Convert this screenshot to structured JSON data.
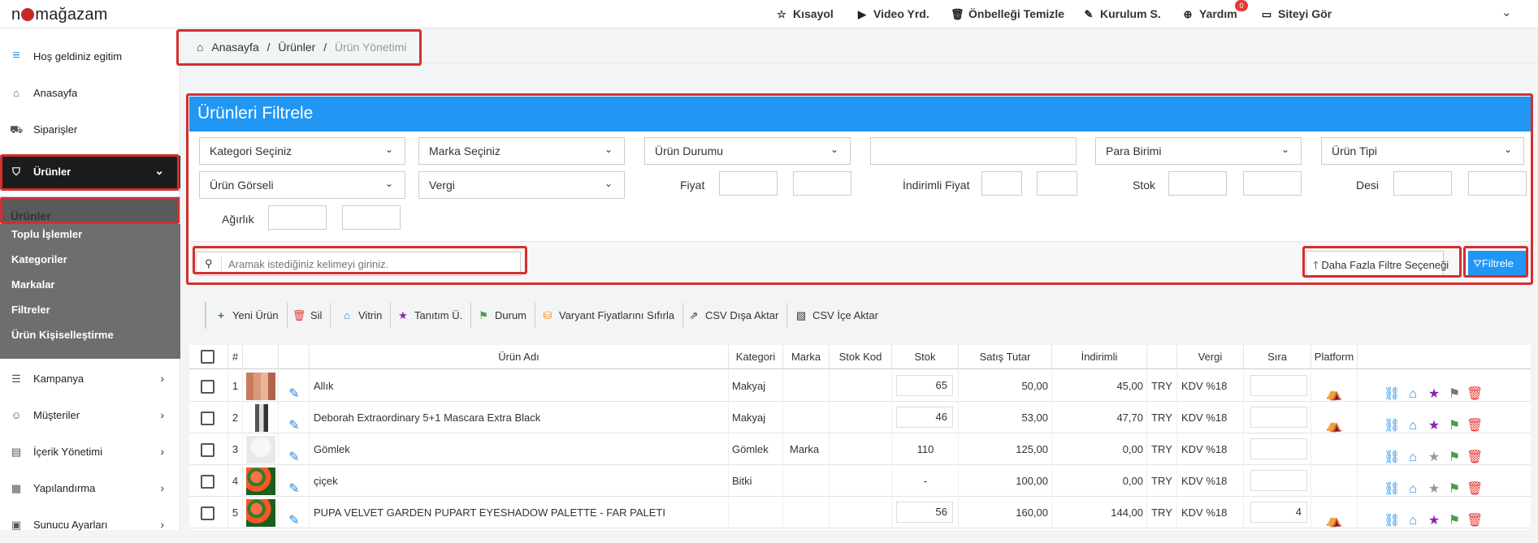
{
  "app": {
    "logo_left": "n",
    "logo_right": "mağazam"
  },
  "topnav": [
    {
      "icon": "star-outline-icon",
      "label": "Kısayol"
    },
    {
      "icon": "youtube-icon",
      "label": "Video Yrd."
    },
    {
      "icon": "trash-icon",
      "label": "Önbelleği Temizle"
    },
    {
      "icon": "magic-wand-icon",
      "label": "Kurulum S."
    },
    {
      "icon": "lifebuoy-icon",
      "label": "Yardım"
    },
    {
      "icon": "monitor-icon",
      "label": "Siteyi Gör"
    }
  ],
  "help_badge": "0",
  "sidebar": {
    "welcome": "Hoş geldiniz egitim",
    "items": [
      {
        "icon": "home-icon",
        "label": "Anasayfa"
      },
      {
        "icon": "cart-icon",
        "label": "Siparişler"
      },
      {
        "icon": "tag-icon",
        "label": "Ürünler"
      },
      {
        "icon": "list-icon",
        "label": "Kampanya"
      },
      {
        "icon": "user-icon",
        "label": "Müşteriler"
      },
      {
        "icon": "document-icon",
        "label": "İçerik Yönetimi"
      },
      {
        "icon": "settings-icon",
        "label": "Yapılandırma"
      },
      {
        "icon": "server-icon",
        "label": "Sunucu Ayarları"
      }
    ],
    "subitems": [
      "Ürünler",
      "Toplu İşlemler",
      "Kategoriler",
      "Markalar",
      "Filtreler",
      "Ürün Kişiselleştirme"
    ]
  },
  "breadcrumb": {
    "home": "Anasayfa",
    "sep": "/",
    "level2": "Ürünler",
    "current": "Ürün Yönetimi"
  },
  "filter": {
    "title": "Ürünleri Filtrele",
    "selects": [
      "Kategori Seçiniz",
      "Marka Seçiniz",
      "Ürün Durumu",
      "Para Birimi",
      "Ürün Tipi",
      "Ürün Görseli",
      "Vergi"
    ],
    "labels": [
      "Fiyat",
      "İndirimli Fiyat",
      "Stok",
      "Desi",
      "Ağırlık"
    ],
    "search_placeholder": "Aramak istediğiniz kelimeyi giriniz.",
    "more_label": "Daha Fazla Filtre Seçeneği",
    "filter_label": "Filtrele"
  },
  "toolbar": [
    "Yeni Ürün",
    "Sil",
    "Vitrin",
    "Tanıtım Ü.",
    "Durum",
    "Varyant Fiyatlarını Sıfırla",
    "CSV Dışa Aktar",
    "CSV İçe Aktar"
  ],
  "colors": {
    "accent": "#2196f3",
    "highlight": "#d32f2f",
    "sidebar_active": "#1c1c1c",
    "submenu": "#6e6e6e",
    "green": "#2e7d32",
    "purple": "#8e24aa"
  },
  "table": {
    "headers": [
      "#",
      "Ürün Adı",
      "Kategori",
      "Marka",
      "Stok Kod",
      "Stok",
      "Satış Tutar",
      "İndirimli",
      "Vergi",
      "Sıra",
      "Platform"
    ],
    "rows": [
      {
        "n": "1",
        "name": "Allık",
        "cat": "Makyaj",
        "brand": "",
        "code": "",
        "stock": "65",
        "price": "50,00",
        "disc": "45,00",
        "cur": "TRY",
        "tax": "KDV %18",
        "order": "",
        "star": "purple",
        "flag": "gray"
      },
      {
        "n": "2",
        "name": "Deborah Extraordinary 5+1 Mascara Extra Black",
        "cat": "Makyaj",
        "brand": "",
        "code": "",
        "stock": "46",
        "price": "53,00",
        "disc": "47,70",
        "cur": "TRY",
        "tax": "KDV %18",
        "order": "",
        "star": "purple",
        "flag": "green"
      },
      {
        "n": "3",
        "name": "Gömlek",
        "cat": "Gömlek",
        "brand": "Marka",
        "code": "",
        "stock": "110",
        "price": "125,00",
        "disc": "0,00",
        "cur": "TRY",
        "tax": "KDV %18",
        "order": "",
        "star": "gray",
        "flag": "green"
      },
      {
        "n": "4",
        "name": "çiçek",
        "cat": "Bitki",
        "brand": "",
        "code": "",
        "stock": "-",
        "price": "100,00",
        "disc": "0,00",
        "cur": "TRY",
        "tax": "KDV %18",
        "order": "",
        "star": "gray",
        "flag": "green"
      },
      {
        "n": "5",
        "name": "PUPA VELVET GARDEN PUPART EYESHADOW PALETTE - FAR PALETI",
        "cat": "",
        "brand": "",
        "code": "",
        "stock": "56",
        "price": "160,00",
        "disc": "144,00",
        "cur": "TRY",
        "tax": "KDV %18",
        "order": "4",
        "star": "purple",
        "flag": "green"
      }
    ]
  }
}
